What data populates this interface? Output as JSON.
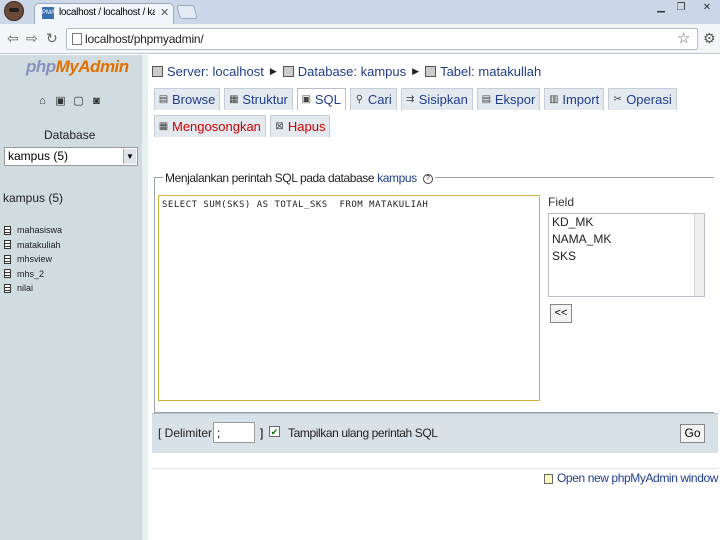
{
  "browser": {
    "tab_title": "localhost / localhost / kampus",
    "tab_favicon": "PMA",
    "url": "localhost/phpmyadmin/",
    "icons": [
      "back-icon",
      "forward-icon",
      "reload-icon",
      "star-icon",
      "wrench-icon",
      "minimize-icon",
      "maximize-icon",
      "close-icon"
    ]
  },
  "left": {
    "logo": {
      "php": "php",
      "my": "My",
      "admin": "Admin"
    },
    "database_label": "Database",
    "database_select": "kampus (5)",
    "db_heading": "kampus (5)",
    "tables": [
      "mahasiswa",
      "matakuliah",
      "mhsview",
      "mhs_2",
      "nilai"
    ]
  },
  "breadcrumb": {
    "server": "Server: localhost",
    "database": "Database: kampus",
    "table": "Tabel: matakullah"
  },
  "tabs": [
    {
      "label": "Browse",
      "icon": "browse-icon"
    },
    {
      "label": "Struktur",
      "icon": "structure-icon"
    },
    {
      "label": "SQL",
      "icon": "sql-icon",
      "active": true
    },
    {
      "label": "Cari",
      "icon": "search-icon"
    },
    {
      "label": "Sisipkan",
      "icon": "insert-icon"
    },
    {
      "label": "Ekspor",
      "icon": "export-icon"
    },
    {
      "label": "Import",
      "icon": "import-icon"
    },
    {
      "label": "Operasi",
      "icon": "operations-icon"
    }
  ],
  "tabs2": [
    {
      "label": "Mengosongkan",
      "icon": "empty-icon"
    },
    {
      "label": "Hapus",
      "icon": "drop-icon"
    }
  ],
  "sql": {
    "legend_prefix": "Menjalankan perintah SQL pada database ",
    "legend_db": "kampus",
    "query": "SELECT SUM(SKS) AS TOTAL_SKS  FROM MATAKULIAH",
    "field_label": "Field",
    "fields": [
      "KD_MK",
      "NAMA_MK",
      "SKS"
    ],
    "insert_button": "<<"
  },
  "options": {
    "delimiter_label": "[ Delimiter",
    "delimiter_value": ";",
    "bracket_close": "]",
    "show_query_label": "Tampilkan ulang perintah SQL",
    "show_query_checked": true,
    "go_button": "Go"
  },
  "footer": {
    "open_window": "Open new phpMyAdmin window"
  }
}
